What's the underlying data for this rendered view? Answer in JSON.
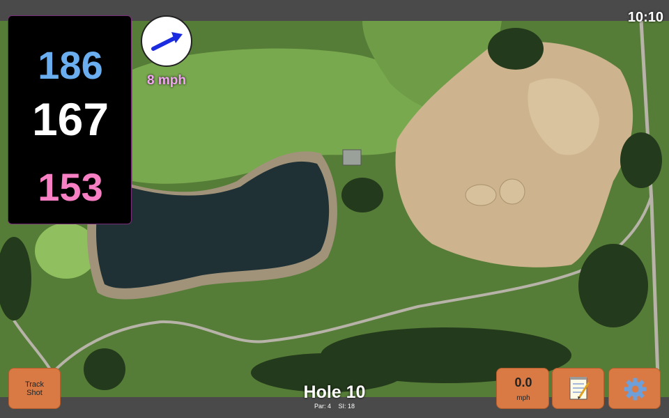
{
  "status": {
    "clock": "10:10"
  },
  "yardages": {
    "back": "186",
    "middle": "167",
    "front": "153"
  },
  "wind": {
    "speed": "8 mph",
    "direction_icon": "arrow-right-up-icon"
  },
  "hole": {
    "title": "Hole 10",
    "par": "Par: 4",
    "stroke_index": "SI: 18"
  },
  "buttons": {
    "track_shot": {
      "line1": "Track",
      "line2": "Shot"
    },
    "speed": {
      "value": "0.0",
      "unit": "mph"
    },
    "notes_icon": "notepad-icon",
    "settings_icon": "gear-icon"
  },
  "colors": {
    "back": "#6aaef0",
    "middle": "#ffffff",
    "front": "#f77fc3",
    "button": "#d97a44",
    "wind_text": "#f2a6f2",
    "arrow": "#1a2be0"
  }
}
